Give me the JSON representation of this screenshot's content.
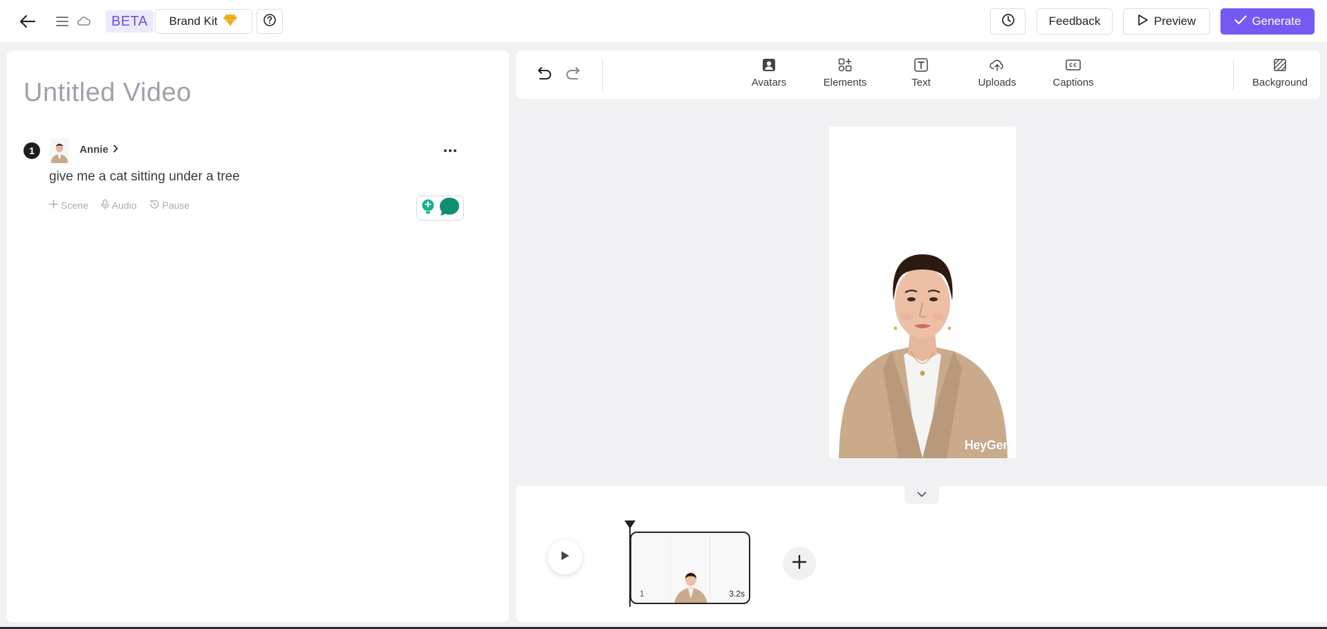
{
  "header": {
    "beta_label": "BETA",
    "brand_kit_label": "Brand Kit",
    "feedback_label": "Feedback",
    "preview_label": "Preview",
    "generate_label": "Generate"
  },
  "editor": {
    "title_placeholder": "Untitled Video",
    "scenes": [
      {
        "number": "1",
        "avatar_name": "Annie",
        "script": "give me a cat sitting under a tree",
        "actions": [
          "Scene",
          "Audio",
          "Pause"
        ]
      }
    ]
  },
  "toolbar": {
    "tools": [
      "Avatars",
      "Elements",
      "Text",
      "Uploads",
      "Captions"
    ],
    "background_label": "Background"
  },
  "canvas": {
    "watermark": "HeyGen"
  },
  "timeline": {
    "clips": [
      {
        "index": "1",
        "duration": "3.2s"
      }
    ]
  },
  "colors": {
    "accent": "#7559f2",
    "beta_bg": "#ede9fe",
    "beta_text": "#6c4ee0",
    "assist_green": "#0f8f6f"
  }
}
